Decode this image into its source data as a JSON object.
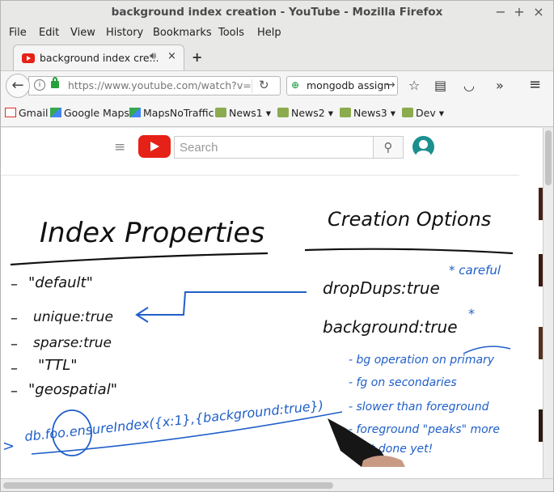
{
  "window": {
    "title": "background index creation - YouTube - Mozilla Firefox",
    "controls": [
      "−",
      "+",
      "×"
    ]
  },
  "menu": [
    "File",
    "Edit",
    "View",
    "History",
    "Bookmarks",
    "Tools",
    "Help"
  ],
  "tab": {
    "label": "background index cre...",
    "sound_icon": "speaker-icon",
    "close": "×",
    "new_tab": "+"
  },
  "nav": {
    "url": "https://www.youtube.com/watch?v=r",
    "search_query": "mongodb assign"
  },
  "bookmarks": [
    {
      "label": "Gmail",
      "icon": "gmail-icon"
    },
    {
      "label": "Google Maps",
      "icon": "maps-icon"
    },
    {
      "label": "MapsNoTraffic",
      "icon": "maps-icon"
    },
    {
      "label": "News1",
      "icon": "folder-icon"
    },
    {
      "label": "News2",
      "icon": "folder-icon"
    },
    {
      "label": "News3",
      "icon": "folder-icon"
    },
    {
      "label": "Dev",
      "icon": "folder-icon"
    }
  ],
  "youtube": {
    "search_placeholder": "Search"
  },
  "whiteboard": {
    "left_heading": "Index Properties",
    "right_heading": "Creation Options",
    "left_items": [
      "\"default\"",
      "unique:true",
      "sparse:true",
      "\"TTL\"",
      "\"geospatial\""
    ],
    "right_items": [
      "dropDups:true",
      "background:true"
    ],
    "note_careful": "* careful",
    "note_star": "*",
    "blue_notes": [
      "- bg operation on primary",
      "- fg on secondaries",
      "- slower than foreground",
      "- foreground \"peaks\" more",
      "- not done yet!"
    ],
    "command": "db.foo.ensureIndex({x:1},{background:true})",
    "prompt": ">"
  }
}
